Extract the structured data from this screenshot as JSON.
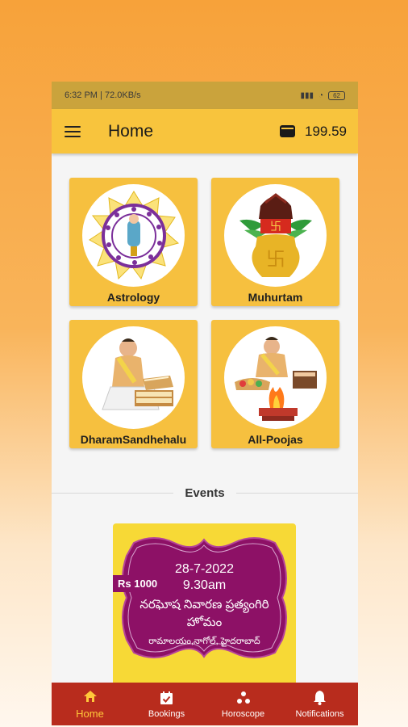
{
  "status_bar": {
    "time": "6:32 PM",
    "speed": "72.0KB/s",
    "battery": "62"
  },
  "app_bar": {
    "title": "Home",
    "wallet_balance": "199.59"
  },
  "tiles": [
    {
      "label": "Astrology",
      "icon": "zodiac-wheel-icon"
    },
    {
      "label": "Muhurtam",
      "icon": "kalash-icon"
    },
    {
      "label": "DharamSandhehalu",
      "icon": "priest-reading-icon"
    },
    {
      "label": "All-Poojas",
      "icon": "homam-fire-icon"
    }
  ],
  "events": {
    "heading": "Events",
    "item": {
      "price": "Rs 1000",
      "date": "28-7-2022",
      "time": "9.30am",
      "title": "నరఘోష నివారణ ప్రత్యంగిరి హోమం",
      "place": "రామాలయం,నాగోల్, హైదరాబాద్"
    }
  },
  "bottom_nav": [
    {
      "label": "Home",
      "icon": "home-icon",
      "active": true
    },
    {
      "label": "Bookings",
      "icon": "calendar-check-icon",
      "active": false
    },
    {
      "label": "Horoscope",
      "icon": "horoscope-dots-icon",
      "active": false
    },
    {
      "label": "Notifications",
      "icon": "bell-icon",
      "active": false
    }
  ],
  "colors": {
    "app_bar": "#f8c43d",
    "tile": "#f6c03f",
    "nav": "#b82c1d",
    "nav_active": "#ffc83a",
    "event_bg": "#8d1166"
  }
}
